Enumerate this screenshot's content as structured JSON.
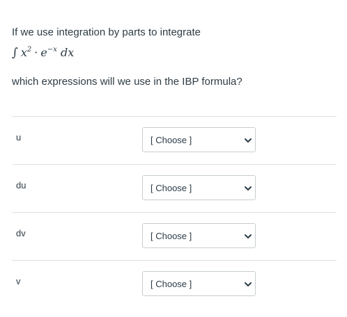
{
  "question": {
    "intro": "If we use integration by parts to integrate",
    "formula": {
      "integral": "∫",
      "base1": "x",
      "exp1": "2",
      "dot": "·",
      "base2": "e",
      "exp2": "−x",
      "differential": "dx"
    },
    "prompt": "which expressions will we use in the IBP formula?"
  },
  "rows": [
    {
      "label": "u",
      "selected": "[ Choose ]"
    },
    {
      "label": "du",
      "selected": "[ Choose ]"
    },
    {
      "label": "dv",
      "selected": "[ Choose ]"
    },
    {
      "label": "v",
      "selected": "[ Choose ]"
    }
  ],
  "icons": {
    "dropdown": "chevron-down-icon"
  }
}
